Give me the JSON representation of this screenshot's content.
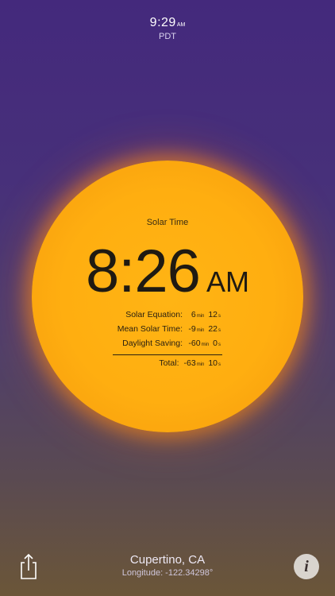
{
  "clock": {
    "time": "9:29",
    "ampm": "AM",
    "timezone": "PDT"
  },
  "sun": {
    "label": "Solar Time",
    "time": "8:26",
    "ampm": "AM",
    "rows": [
      {
        "label": "Solar Equation:",
        "min": "6",
        "min_unit": "min",
        "sec": "12",
        "sec_unit": "s"
      },
      {
        "label": "Mean Solar Time:",
        "min": "-9",
        "min_unit": "min",
        "sec": "22",
        "sec_unit": "s"
      },
      {
        "label": "Daylight Saving:",
        "min": "-60",
        "min_unit": "min",
        "sec": "0",
        "sec_unit": "s"
      }
    ],
    "total": {
      "label": "Total:",
      "min": "-63",
      "min_unit": "min",
      "sec": "10",
      "sec_unit": "s"
    }
  },
  "location": {
    "city": "Cupertino, CA",
    "longitude": "Longitude: -122.34298°"
  },
  "buttons": {
    "info": "i"
  },
  "icons": {
    "share": "share-icon",
    "info": "info-icon"
  },
  "colors": {
    "sun": "#ffae10",
    "background_top": "#44297c",
    "background_bottom": "#6b5638"
  }
}
